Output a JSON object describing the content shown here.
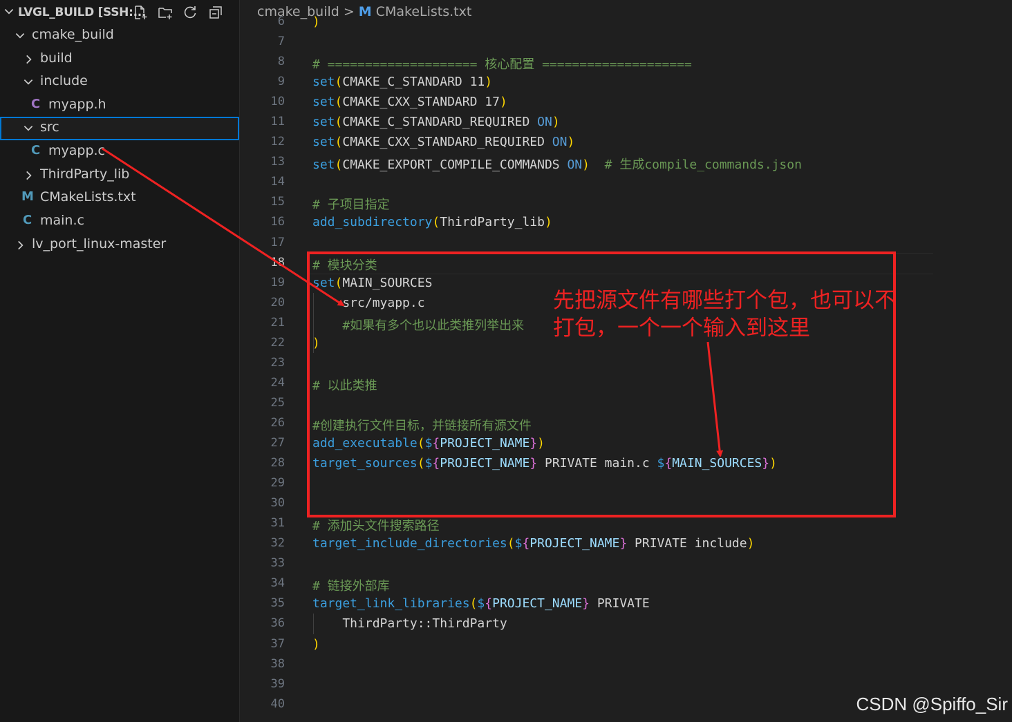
{
  "sidebar": {
    "title": "LVGL_BUILD [SSH:...",
    "actions": [
      {
        "name": "new-file-icon"
      },
      {
        "name": "new-folder-icon"
      },
      {
        "name": "refresh-icon"
      },
      {
        "name": "collapse-all-icon"
      }
    ],
    "tree": [
      {
        "label": "cmake_build",
        "kind": "folder-open"
      },
      {
        "label": "build",
        "kind": "folder-closed"
      },
      {
        "label": "include",
        "kind": "folder-open"
      },
      {
        "label": "myapp.h",
        "kind": "file-c",
        "icon_text": "C",
        "icon_color": "#a074c4"
      },
      {
        "label": "src",
        "kind": "folder-open",
        "selected": true
      },
      {
        "label": "myapp.c",
        "kind": "file-c",
        "icon_text": "C",
        "icon_color": "#519aba"
      },
      {
        "label": "ThirdParty_lib",
        "kind": "folder-closed"
      },
      {
        "label": "CMakeLists.txt",
        "kind": "file-m",
        "icon_text": "M",
        "icon_color": "#519aba"
      },
      {
        "label": "main.c",
        "kind": "file-c",
        "icon_text": "C",
        "icon_color": "#519aba"
      },
      {
        "label": "lv_port_linux-master",
        "kind": "folder-closed"
      }
    ]
  },
  "breadcrumb": {
    "folder": "cmake_build",
    "separator": ">",
    "file_icon": "M",
    "file": "CMakeLists.txt"
  },
  "editor": {
    "current_line": "18",
    "lines": [
      {
        "n": "6",
        "code": ")"
      },
      {
        "n": "7",
        "code": ""
      },
      {
        "n": "8",
        "code": "# ==================== 核心配置 ===================="
      },
      {
        "n": "9",
        "code": "set(CMAKE_C_STANDARD 11)"
      },
      {
        "n": "10",
        "code": "set(CMAKE_CXX_STANDARD 17)"
      },
      {
        "n": "11",
        "code": "set(CMAKE_C_STANDARD_REQUIRED ON)"
      },
      {
        "n": "12",
        "code": "set(CMAKE_CXX_STANDARD_REQUIRED ON)"
      },
      {
        "n": "13",
        "code": "set(CMAKE_EXPORT_COMPILE_COMMANDS ON)  # 生成compile_commands.json"
      },
      {
        "n": "14",
        "code": ""
      },
      {
        "n": "15",
        "code": "# 子项目指定"
      },
      {
        "n": "16",
        "code": "add_subdirectory(ThirdParty_lib)"
      },
      {
        "n": "17",
        "code": ""
      },
      {
        "n": "18",
        "code": "# 模块分类"
      },
      {
        "n": "19",
        "code": "set(MAIN_SOURCES"
      },
      {
        "n": "20",
        "code": "    src/myapp.c"
      },
      {
        "n": "21",
        "code": "    #如果有多个也以此类推列举出来"
      },
      {
        "n": "22",
        "code": ")"
      },
      {
        "n": "23",
        "code": ""
      },
      {
        "n": "24",
        "code": "# 以此类推"
      },
      {
        "n": "25",
        "code": ""
      },
      {
        "n": "26",
        "code": "#创建执行文件目标，并链接所有源文件"
      },
      {
        "n": "27",
        "code": "add_executable(${PROJECT_NAME})"
      },
      {
        "n": "28",
        "code": "target_sources(${PROJECT_NAME} PRIVATE main.c ${MAIN_SOURCES})"
      },
      {
        "n": "29",
        "code": ""
      },
      {
        "n": "30",
        "code": ""
      },
      {
        "n": "31",
        "code": "# 添加头文件搜索路径"
      },
      {
        "n": "32",
        "code": "target_include_directories(${PROJECT_NAME} PRIVATE include)"
      },
      {
        "n": "33",
        "code": ""
      },
      {
        "n": "34",
        "code": "# 链接外部库"
      },
      {
        "n": "35",
        "code": "target_link_libraries(${PROJECT_NAME} PRIVATE"
      },
      {
        "n": "36",
        "code": "    ThirdParty::ThirdParty"
      },
      {
        "n": "37",
        "code": ")"
      },
      {
        "n": "38",
        "code": ""
      },
      {
        "n": "39",
        "code": ""
      },
      {
        "n": "40",
        "code": ""
      }
    ]
  },
  "annotation": {
    "text": "先把源文件有哪些打个包，也可以不打包，一个一个输入到这里",
    "color": "#ee2222"
  },
  "watermark": "CSDN @Spiffo_Sir",
  "colors": {
    "sidebar_bg": "#181818",
    "editor_bg": "#1f1f1f",
    "selection_border": "#0078d4",
    "function": "#3b9ede",
    "comment": "#6a9955",
    "variable": "#9cdcfe",
    "paren": "#ffd700",
    "brace": "#da70d6"
  }
}
